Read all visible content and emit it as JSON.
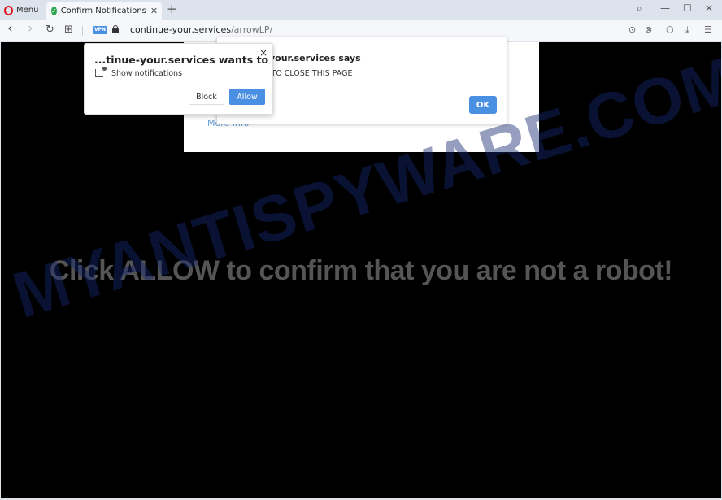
{
  "browser": {
    "menu_label": "Menu",
    "tab": {
      "title": "Confirm Notifications",
      "favicon": "check-icon",
      "close_glyph": "✕"
    },
    "new_tab_glyph": "+",
    "window_controls": {
      "search": "⌕",
      "minimize": "—",
      "maximize": "☐",
      "close": "✕"
    },
    "nav": {
      "back": "‹",
      "forward": "›",
      "reload": "↻",
      "tabs_grid": "⊞"
    },
    "vpn_label": "VPN",
    "url": {
      "host": "continue-your.services",
      "path": "/arrowLP/"
    },
    "toolbar_icons": {
      "snapshot": "⊙",
      "adblock": "⊗",
      "wallet": "⬡",
      "download": "⤓",
      "easy_setup": "☰"
    }
  },
  "page": {
    "more_info": "More info",
    "headline": "Click ALLOW to confirm that you are not a robot!",
    "watermark": "MYANTISPYWARE.COM"
  },
  "alert": {
    "title": "your.services says",
    "message": "W TO CLOSE THIS PAGE",
    "ok_label": "OK"
  },
  "notification": {
    "title": "...tinue-your.services wants to",
    "close_glyph": "×",
    "permission": "Show notifications",
    "block_label": "Block",
    "allow_label": "Allow"
  },
  "colors": {
    "accent": "#4a90e2",
    "opera_red": "#e0161b",
    "tab_check": "#2ea44f"
  }
}
